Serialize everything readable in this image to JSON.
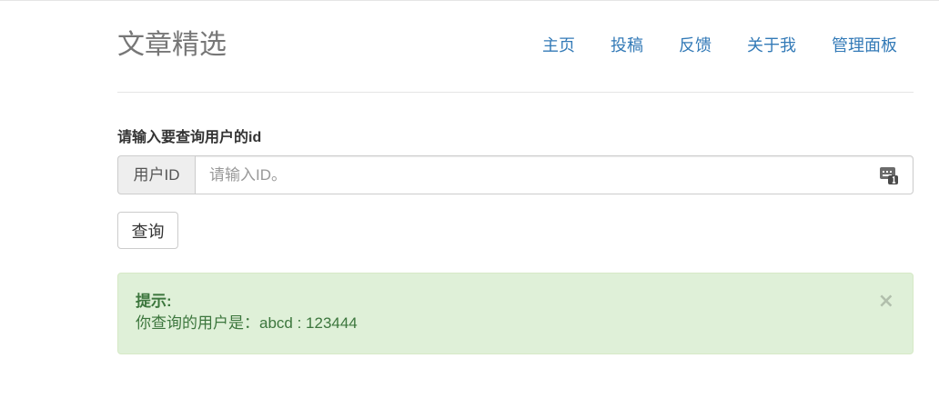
{
  "header": {
    "brand": "文章精选",
    "nav": [
      {
        "label": "主页"
      },
      {
        "label": "投稿"
      },
      {
        "label": "反馈"
      },
      {
        "label": "关于我"
      },
      {
        "label": "管理面板"
      }
    ]
  },
  "form": {
    "label": "请输入要查询用户的id",
    "addon": "用户ID",
    "placeholder": "请输入ID。",
    "value": "",
    "submit_label": "查询"
  },
  "alert": {
    "title": "提示:",
    "message": "你查询的用户是：abcd : 123444",
    "close": "×"
  },
  "icons": {
    "field_icon": "autofill-keyboard-icon",
    "close": "close-icon"
  },
  "colors": {
    "link": "#337ab7",
    "alert_bg": "#dff0d8",
    "alert_text": "#3c763d"
  }
}
